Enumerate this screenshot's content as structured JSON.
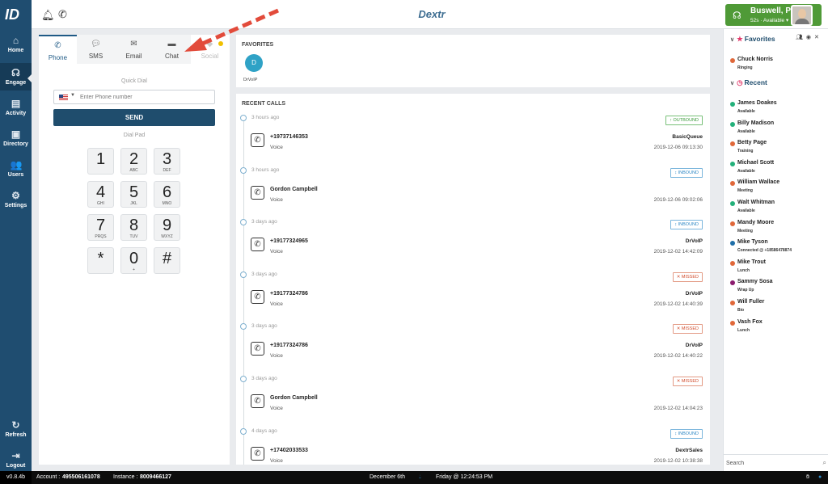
{
  "app": {
    "brand": "Dextr",
    "version": "v0.8.4b"
  },
  "nav": {
    "items": [
      {
        "label": "Home"
      },
      {
        "label": "Engage"
      },
      {
        "label": "Activity"
      },
      {
        "label": "Directory"
      },
      {
        "label": "Users"
      },
      {
        "label": "Settings"
      }
    ],
    "refresh": "Refresh",
    "logout": "Logout"
  },
  "user": {
    "name": "Buswell, Peter",
    "status": "52s · Available ▾"
  },
  "dialer": {
    "tabs": [
      "Phone",
      "SMS",
      "Email",
      "Chat",
      "Social"
    ],
    "quick_dial": "Quick Dial",
    "phone_placeholder": "Enter Phone number",
    "send": "SEND",
    "dial_pad": "Dial Pad",
    "keys": [
      {
        "d": "1",
        "s": ""
      },
      {
        "d": "2",
        "s": "ABC"
      },
      {
        "d": "3",
        "s": "DEF"
      },
      {
        "d": "4",
        "s": "GHI"
      },
      {
        "d": "5",
        "s": "JKL"
      },
      {
        "d": "6",
        "s": "MNO"
      },
      {
        "d": "7",
        "s": "PRQS"
      },
      {
        "d": "8",
        "s": "TUV"
      },
      {
        "d": "9",
        "s": "WXYZ"
      },
      {
        "d": "*",
        "s": ""
      },
      {
        "d": "0",
        "s": "+"
      },
      {
        "d": "#",
        "s": ""
      }
    ]
  },
  "favorites_panel": {
    "title": "FAVORITES",
    "items": [
      {
        "initial": "D",
        "name": "DrVoIP"
      }
    ]
  },
  "recent_calls": {
    "title": "RECENT CALLS",
    "items": [
      {
        "ago": "3 hours ago",
        "direction": "↑ OUTBOUND",
        "dir": "out",
        "number": "+19737146353",
        "type": "Voice",
        "queue": "BasicQueue",
        "datetime": "2019-12-06 09:13:30"
      },
      {
        "ago": "3 hours ago",
        "direction": "↕ INBOUND",
        "dir": "in",
        "number": "Gordon Campbell",
        "type": "Voice",
        "queue": "",
        "datetime": "2019-12-06 09:02:06"
      },
      {
        "ago": "3 days ago",
        "direction": "↕ INBOUND",
        "dir": "in",
        "number": "+19177324965",
        "type": "Voice",
        "queue": "DrVoIP",
        "datetime": "2019-12-02 14:42:09"
      },
      {
        "ago": "3 days ago",
        "direction": "✕ MISSED",
        "dir": "miss",
        "number": "+19177324786",
        "type": "Voice",
        "queue": "DrVoIP",
        "datetime": "2019-12-02 14:40:39"
      },
      {
        "ago": "3 days ago",
        "direction": "✕ MISSED",
        "dir": "miss",
        "number": "+19177324786",
        "type": "Voice",
        "queue": "DrVoIP",
        "datetime": "2019-12-02 14:40:22"
      },
      {
        "ago": "3 days ago",
        "direction": "✕ MISSED",
        "dir": "miss",
        "number": "Gordon Campbell",
        "type": "Voice",
        "queue": "",
        "datetime": "2019-12-02 14:04:23"
      },
      {
        "ago": "4 days ago",
        "direction": "↕ INBOUND",
        "dir": "in",
        "number": "+17402033533",
        "type": "Voice",
        "queue": "DextrSales",
        "datetime": "2019-12-02 10:38:38"
      }
    ]
  },
  "sidebar": {
    "favorites_title": "Favorites",
    "recent_title": "Recent",
    "favorites": [
      {
        "name": "Chuck Norris",
        "status": "Ringing",
        "color": "#e0683a"
      }
    ],
    "recent": [
      {
        "name": "James Doakes",
        "status": "Available",
        "color": "#23b07a"
      },
      {
        "name": "Billy Madison",
        "status": "Available",
        "color": "#23b07a"
      },
      {
        "name": "Betty Page",
        "status": "Training",
        "color": "#e0683a"
      },
      {
        "name": "Michael Scott",
        "status": "Available",
        "color": "#23b07a"
      },
      {
        "name": "William Wallace",
        "status": "Meeting",
        "color": "#e0683a"
      },
      {
        "name": "Walt Whitman",
        "status": "Available",
        "color": "#23b07a"
      },
      {
        "name": "Mandy Moore",
        "status": "Meeting",
        "color": "#e0683a"
      },
      {
        "name": "Mike Tyson",
        "status": "Connected @ +18586478874",
        "color": "#1f6fa8"
      },
      {
        "name": "Mike Trout",
        "status": "Lunch",
        "color": "#e0683a"
      },
      {
        "name": "Sammy Sosa",
        "status": "Wrap Up",
        "color": "#8b1c6e"
      },
      {
        "name": "Will Fuller",
        "status": "Bio",
        "color": "#e0683a"
      },
      {
        "name": "Vash Fox",
        "status": "Lunch",
        "color": "#e0683a"
      }
    ],
    "search_placeholder": "Search"
  },
  "footer": {
    "account_label": "Account :",
    "account": "495506161078",
    "instance_label": "Instance :",
    "instance": "8009466127",
    "date": "December 6th",
    "time": "Friday @ 12:24:53 PM"
  }
}
